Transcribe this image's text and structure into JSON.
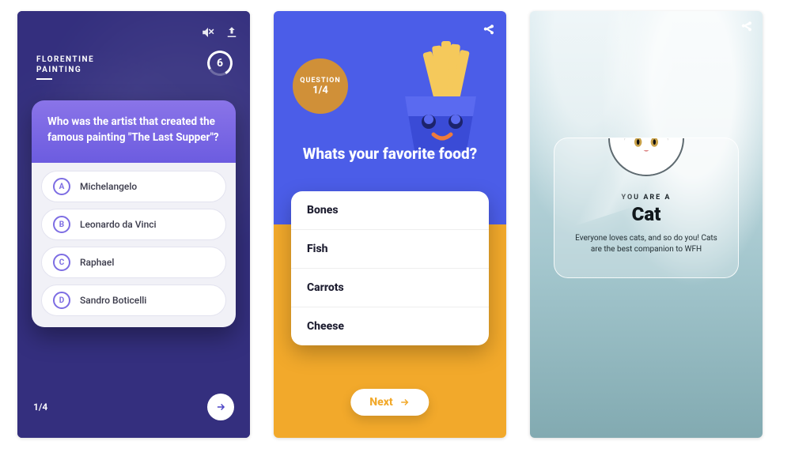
{
  "card1": {
    "category": "FLORENTINE\nPAINTING",
    "timer": "6",
    "question": "Who was the artist that created the famous painting \"The Last Supper\"?",
    "options": [
      {
        "letter": "A",
        "text": "Michelangelo"
      },
      {
        "letter": "B",
        "text": "Leonardo da Vinci"
      },
      {
        "letter": "C",
        "text": "Raphael"
      },
      {
        "letter": "D",
        "text": "Sandro Boticelli"
      }
    ],
    "progress": "1/4",
    "icons": {
      "mute": "mute-icon",
      "share": "share-icon",
      "next": "arrow-right-icon"
    }
  },
  "card2": {
    "badge_label": "QUESTION",
    "badge_value": "1/4",
    "title": "Whats your favorite food?",
    "options": [
      "Bones",
      "Fish",
      "Carrots",
      "Cheese"
    ],
    "next_label": "Next",
    "icons": {
      "share": "share-icon",
      "next": "arrow-right-icon"
    }
  },
  "card3": {
    "pre_title": "YOU ARE A",
    "title": "Cat",
    "description": "Everyone loves cats, and so do you! Cats are the best companion to WFH",
    "icons": {
      "share": "share-icon"
    }
  }
}
